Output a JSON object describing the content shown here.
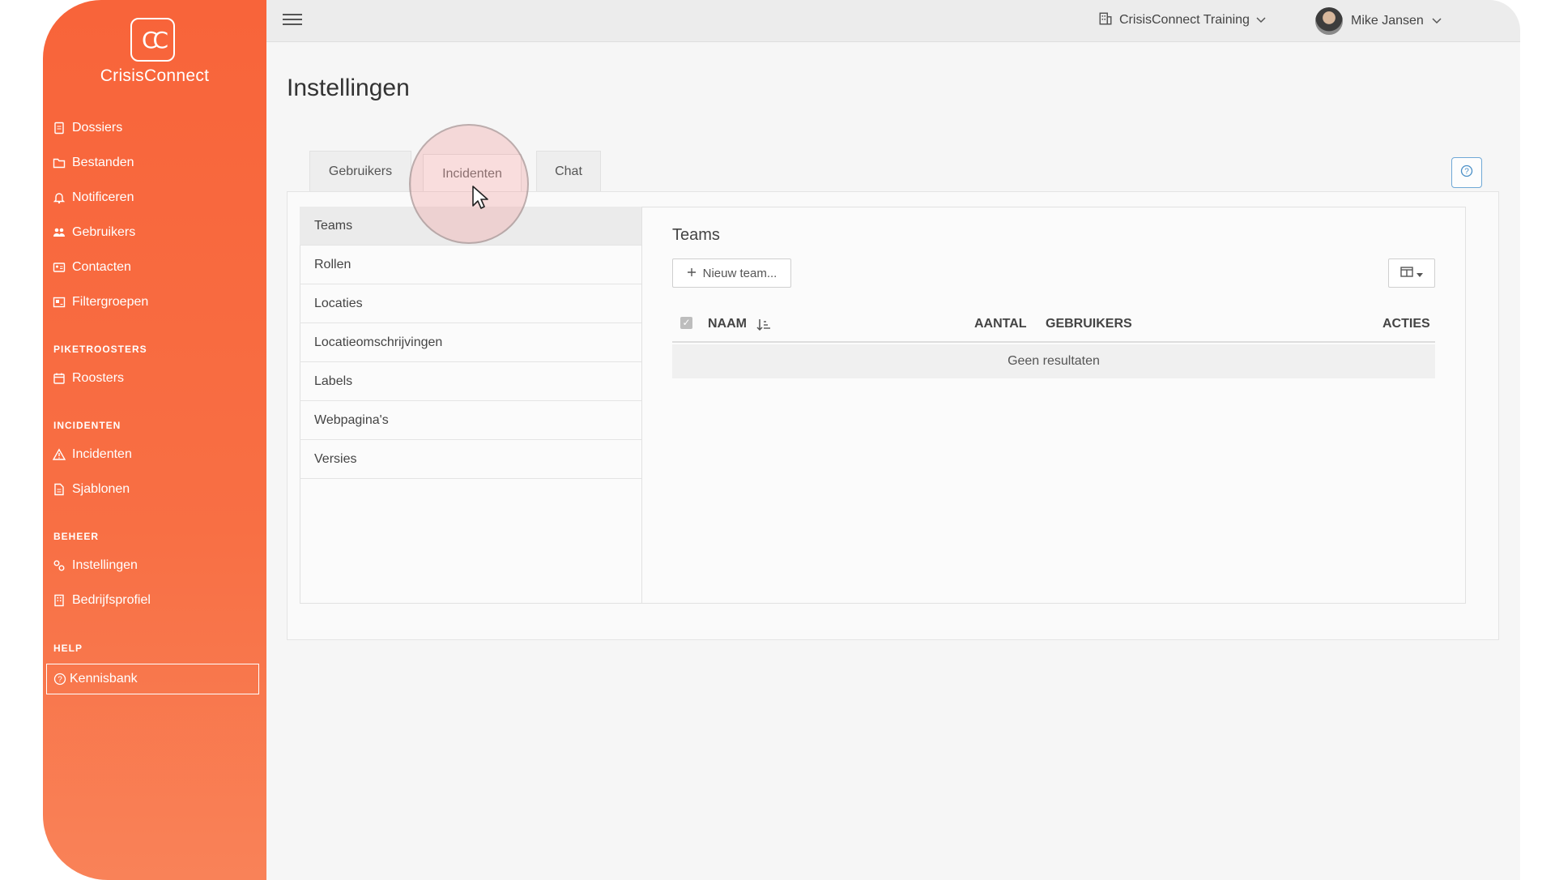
{
  "app": {
    "logo_text": "CrisisConnect",
    "logo_mark": "CC",
    "brand_color": "#f86a3f"
  },
  "sidebar": {
    "items": [
      {
        "label": "Dossiers",
        "icon": "file-icon"
      },
      {
        "label": "Bestanden",
        "icon": "folder-icon"
      },
      {
        "label": "Notificeren",
        "icon": "bell-icon"
      },
      {
        "label": "Gebruikers",
        "icon": "users-icon"
      },
      {
        "label": "Contacten",
        "icon": "contact-card-icon"
      },
      {
        "label": "Filtergroepen",
        "icon": "filter-group-icon"
      }
    ],
    "sections": {
      "piketroosters": "PIKETROOSTERS",
      "incidenten": "INCIDENTEN",
      "beheer": "BEHEER",
      "help": "HELP"
    },
    "roosters": "Roosters",
    "incidenten": "Incidenten",
    "sjablonen": "Sjablonen",
    "instellingen": "Instellingen",
    "bedrijfsprofiel": "Bedrijfsprofiel",
    "kennisbank": "Kennisbank"
  },
  "topbar": {
    "tenant": "CrisisConnect Training",
    "user": "Mike Jansen",
    "language_flag": "nl-flag"
  },
  "page": {
    "title": "Instellingen",
    "tabs": [
      "Gebruikers",
      "Incidenten",
      "Chat"
    ],
    "active_tab": "Incidenten"
  },
  "submenu": {
    "items": [
      "Teams",
      "Rollen",
      "Locaties",
      "Locatieomschrijvingen",
      "Labels",
      "Webpagina's",
      "Versies"
    ],
    "active": "Teams"
  },
  "content": {
    "title": "Teams",
    "new_button": "Nieuw team...",
    "columns": [
      "NAAM",
      "AANTAL",
      "GEBRUIKERS",
      "ACTIES"
    ],
    "empty_text": "Geen resultaten"
  }
}
